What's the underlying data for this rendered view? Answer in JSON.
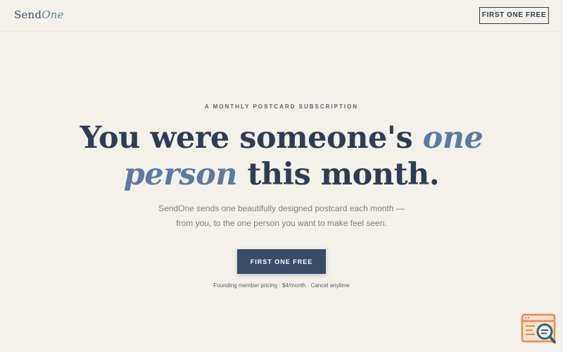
{
  "header": {
    "logo_regular": "Send",
    "logo_italic": "One",
    "cta_label": "FIRST ONE FREE"
  },
  "hero": {
    "eyebrow": "A MONTHLY POSTCARD SUBSCRIPTION",
    "headline_part1": "You were someone's ",
    "headline_italic": "one person",
    "headline_part2": " this month.",
    "subtitle_line1": "SendOne sends one beautifully designed postcard each month —",
    "subtitle_line2": "from you, to the one person you want to make feel seen.",
    "cta_label": "FIRST ONE FREE",
    "fine_print": "Founding member pricing · $4/month · Cancel anytime"
  },
  "colors": {
    "background": "#f4f1eb",
    "navy": "#2f3d52",
    "accent_blue": "#5b7aa0",
    "button": "#3a4b66",
    "widget_orange": "#e98a4a",
    "widget_teal": "#2f6470"
  },
  "widget": {
    "icon": "search-document-icon"
  }
}
